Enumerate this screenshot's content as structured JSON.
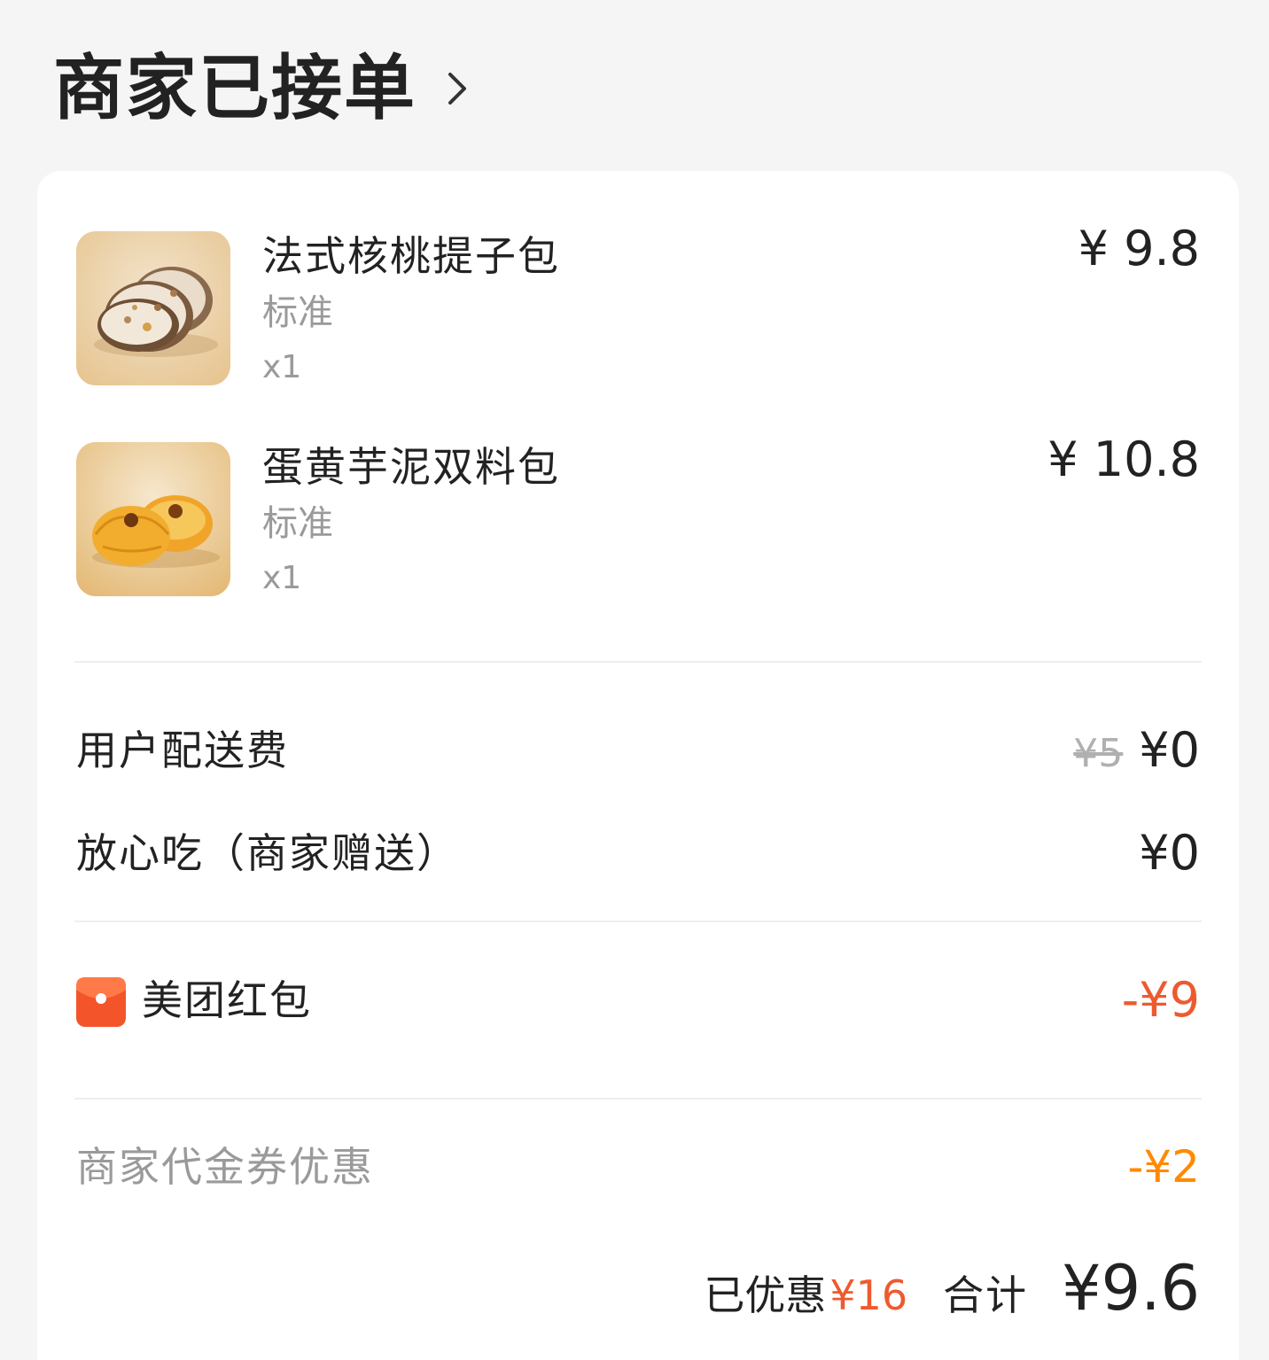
{
  "header": {
    "title": "商家已接单"
  },
  "products": [
    {
      "name": "法式核桃提子包",
      "spec": "标准",
      "qty": "x1",
      "price": "¥ 9.8"
    },
    {
      "name": "蛋黄芋泥双料包",
      "spec": "标准",
      "qty": "x1",
      "price": "¥ 10.8"
    }
  ],
  "fees": {
    "delivery": {
      "label": "用户配送费",
      "original": "¥5",
      "value": "¥0"
    },
    "assurance": {
      "label": "放心吃（商家赠送）",
      "value": "¥0"
    }
  },
  "red_packet": {
    "label": "美团红包",
    "value": "-¥9"
  },
  "coupon": {
    "label": "商家代金券优惠",
    "value": "-¥2"
  },
  "totals": {
    "saved_label": "已优惠",
    "saved_value": "¥16",
    "total_label": "合计",
    "total_value": "¥9.6"
  },
  "colors": {
    "accent_red": "#ee5a2f",
    "accent_orange": "#ff8a00",
    "muted_text": "#9a9a9a"
  }
}
